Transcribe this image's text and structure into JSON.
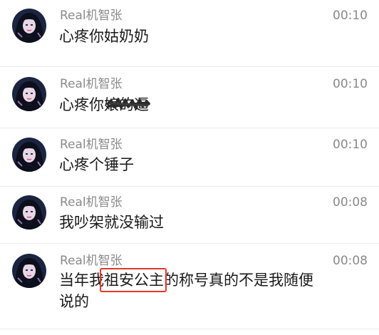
{
  "comments": [
    {
      "author": "Real机智张",
      "time": "00:10",
      "text": "心疼你姑奶奶"
    },
    {
      "author": "Real机智张",
      "time": "00:10",
      "text": "心疼你",
      "text_obscured": "娘的逼"
    },
    {
      "author": "Real机智张",
      "time": "00:10",
      "text": "心疼个锤子"
    },
    {
      "author": "Real机智张",
      "time": "00:08",
      "text": "我吵架就没输过"
    },
    {
      "author": "Real机智张",
      "time": "00:08",
      "text_before": "当年我",
      "text_highlight": "祖安公主",
      "text_after": "的称号真的不是我随便",
      "text_line2": "说的"
    }
  ],
  "colors": {
    "author": "#8a8a8a",
    "text": "#1a1a1a",
    "divider": "#e9e9e9",
    "highlight": "#e0392b",
    "background": "#ffffff"
  },
  "icons": {
    "avatar": "avatar-girl-dark-hair"
  }
}
